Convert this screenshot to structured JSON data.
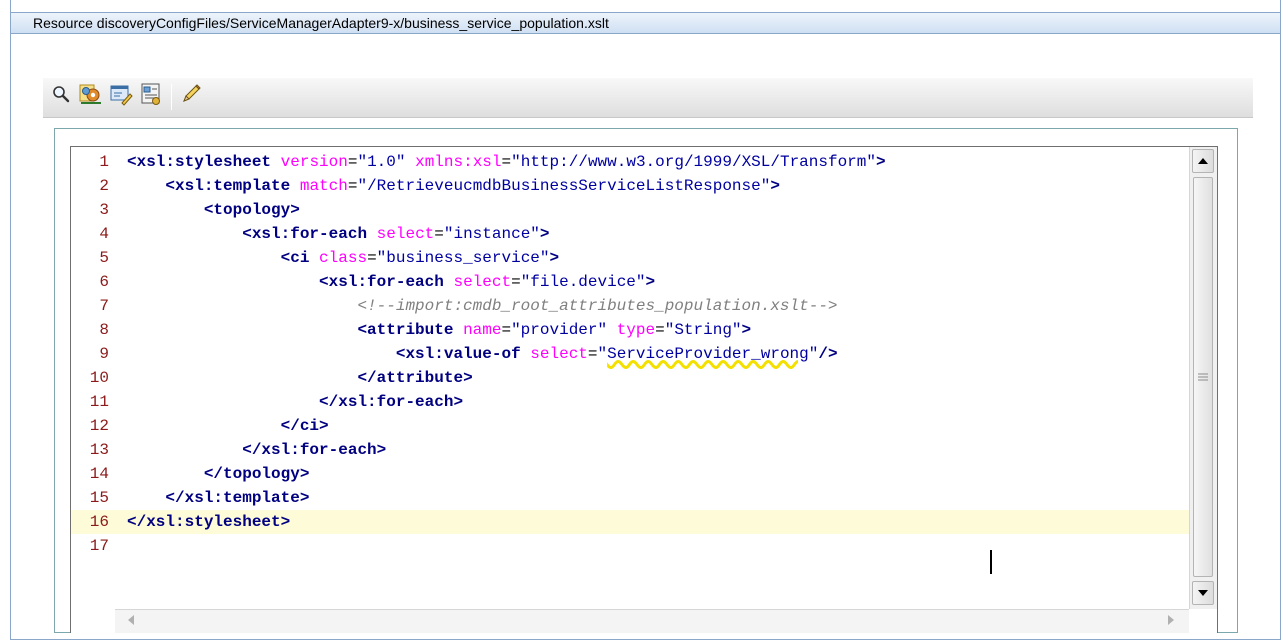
{
  "window": {
    "title": "Resource discoveryConfigFiles/ServiceManagerAdapter9-x/business_service_population.xslt"
  },
  "toolbar": {
    "buttons": [
      {
        "icon": "magnifier-icon"
      },
      {
        "icon": "gears-icon"
      },
      {
        "icon": "edit-form-icon"
      },
      {
        "icon": "properties-icon"
      },
      {
        "icon": "pencil-icon"
      }
    ]
  },
  "editor": {
    "current_line": 16,
    "lines": [
      {
        "n": "1",
        "text": "<xsl:stylesheet version=\"1.0\" xmlns:xsl=\"http://www.w3.org/1999/XSL/Transform\">"
      },
      {
        "n": "2",
        "text": "    <xsl:template match=\"/RetrieveucmdbBusinessServiceListResponse\">"
      },
      {
        "n": "3",
        "text": "        <topology>"
      },
      {
        "n": "4",
        "text": "            <xsl:for-each select=\"instance\">"
      },
      {
        "n": "5",
        "text": "                <ci class=\"business_service\">"
      },
      {
        "n": "6",
        "text": "                    <xsl:for-each select=\"file.device\">"
      },
      {
        "n": "7",
        "text": "                        <!--import:cmdb_root_attributes_population.xslt-->"
      },
      {
        "n": "8",
        "text": "                        <attribute name=\"provider\" type=\"String\">"
      },
      {
        "n": "9",
        "text": "                            <xsl:value-of select=\"ServiceProvider_wrong\"/>"
      },
      {
        "n": "10",
        "text": "                        </attribute>"
      },
      {
        "n": "11",
        "text": "                    </xsl:for-each>"
      },
      {
        "n": "12",
        "text": "                </ci>"
      },
      {
        "n": "13",
        "text": "            </xsl:for-each>"
      },
      {
        "n": "14",
        "text": "        </topology>"
      },
      {
        "n": "15",
        "text": "    </xsl:template>"
      },
      {
        "n": "16",
        "text": "</xsl:stylesheet>"
      },
      {
        "n": "17",
        "text": ""
      }
    ],
    "highlighted_error_value": "ServiceProvider_wrong",
    "colors": {
      "tag": "#000080",
      "attribute": "#ff00ff",
      "value": "#0000a0",
      "comment": "#808080",
      "line_number": "#8b1a1a",
      "current_line_bg": "#fdfbd8",
      "error_underline": "#f3e000"
    }
  },
  "scrollbars": {
    "vertical": {
      "up": "scroll-up-arrow-icon",
      "down": "scroll-down-arrow-icon",
      "grip": "grip-icon"
    },
    "horizontal": {
      "left": "scroll-left-arrow-icon",
      "right": "scroll-right-arrow-icon"
    }
  }
}
